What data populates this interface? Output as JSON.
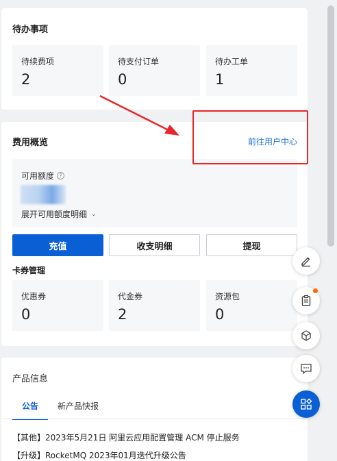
{
  "todo": {
    "title": "待办事项",
    "stats": [
      {
        "label": "待续费项",
        "value": "2"
      },
      {
        "label": "待支付订单",
        "value": "0"
      },
      {
        "label": "待办工单",
        "value": "1"
      }
    ]
  },
  "fee": {
    "title": "费用概览",
    "link": "前往用户中心",
    "credit_label": "可用额度",
    "expand_label": "展开可用额度明细",
    "buttons": {
      "recharge": "充值",
      "detail": "收支明细",
      "withdraw": "提现"
    },
    "coupon_title": "卡券管理",
    "coupons": [
      {
        "label": "优惠券",
        "value": "0"
      },
      {
        "label": "代金券",
        "value": "2"
      },
      {
        "label": "资源包",
        "value": "0"
      }
    ]
  },
  "product": {
    "title": "产品信息",
    "tabs": [
      "公告",
      "新产品快报"
    ],
    "news": [
      "【其他】2023年5月21日 阿里云应用配置管理 ACM 停止服务",
      "【升级】RocketMQ 2023年01月迭代升级公告"
    ]
  },
  "icons": {
    "fab": [
      "edit-icon",
      "clipboard-icon",
      "cube-icon",
      "chat-icon",
      "apps-icon"
    ]
  },
  "colors": {
    "accent": "#0a5fd4",
    "annotation": "#e8262b",
    "badge": "#ff6a00"
  }
}
